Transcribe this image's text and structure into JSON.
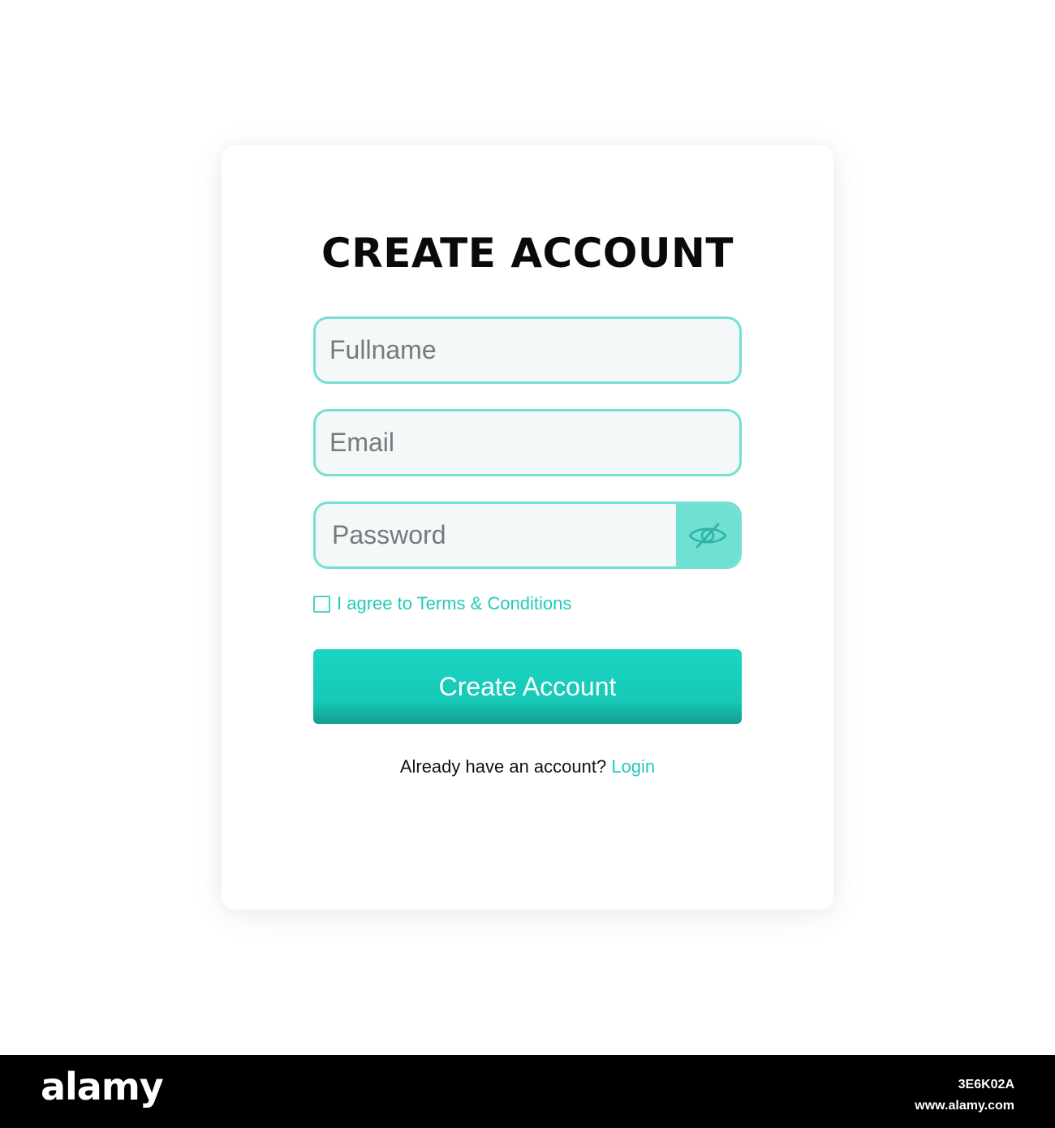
{
  "form": {
    "title": "CREATE ACCOUNT",
    "fullname_placeholder": "Fullname",
    "email_placeholder": "Email",
    "password_placeholder": "Password",
    "password_toggle_icon": "eye-slash-icon",
    "terms_label": "I agree to Terms & Conditions",
    "terms_checked": false,
    "submit_label": "Create Account",
    "login_prompt": "Already have an account?",
    "login_link": "Login"
  },
  "footer": {
    "brand": "alamy",
    "image_id": "3E6K02A",
    "site": "www.alamy.com"
  },
  "colors": {
    "accent": "#1ad5c3",
    "field_border": "#74dfd2",
    "field_bg": "#f5f8f8",
    "toggle_bg": "#70e0d3",
    "footer_bg": "#000000"
  }
}
